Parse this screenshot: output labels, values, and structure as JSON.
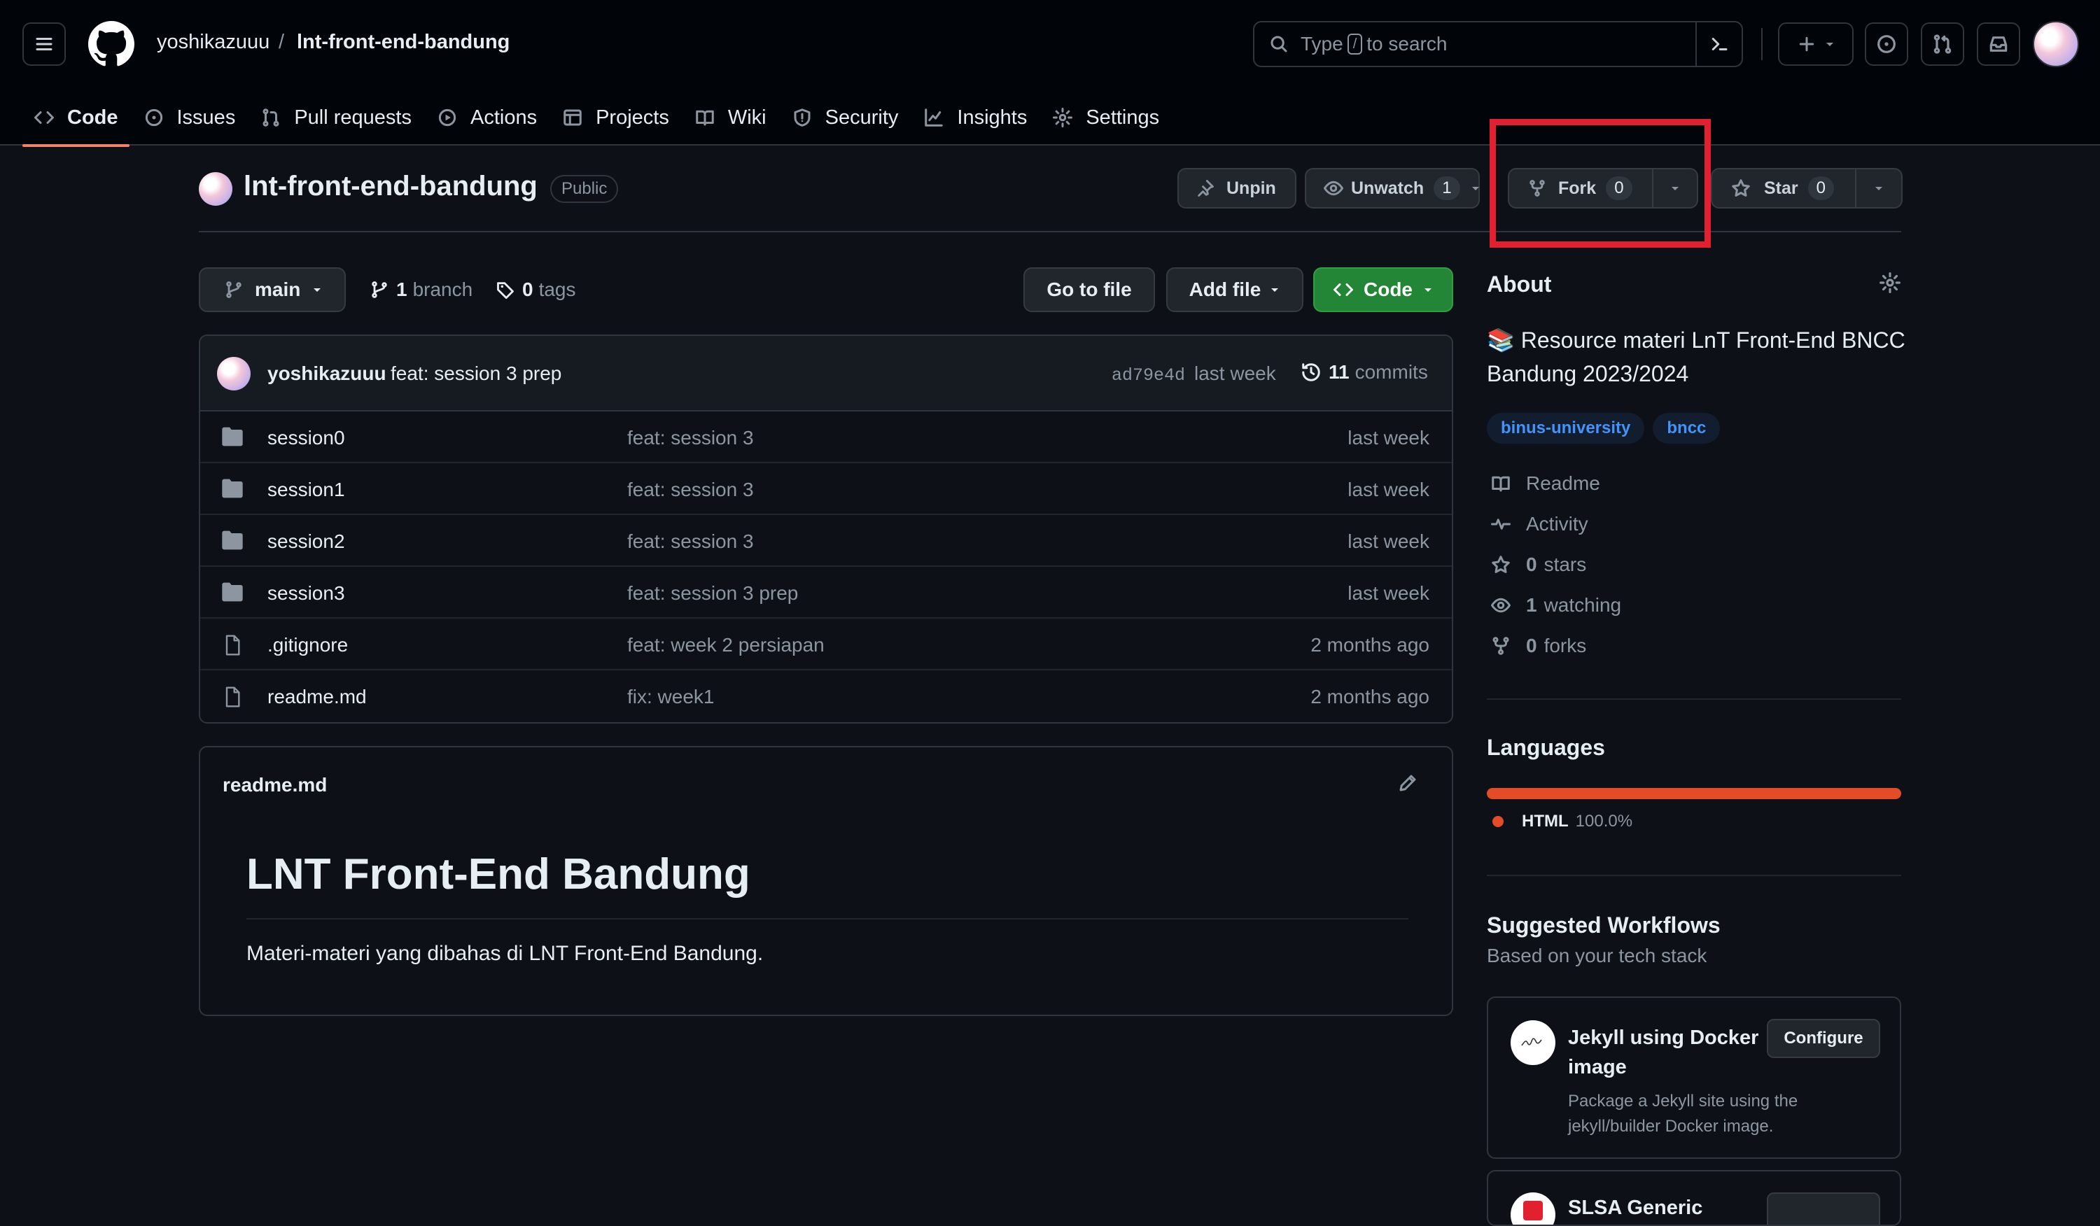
{
  "header": {
    "owner": "yoshikazuuu",
    "separator": "/",
    "repo": "lnt-front-end-bandung",
    "search": {
      "prefix": "Type",
      "key": "/",
      "suffix": "to search"
    },
    "icons": [
      "menu-icon",
      "github-logo",
      "search-icon",
      "command-palette-icon",
      "plus-icon",
      "issue-icon",
      "pull-request-icon",
      "inbox-icon"
    ]
  },
  "tabs": [
    {
      "label": "Code",
      "icon": "code-icon",
      "active": true
    },
    {
      "label": "Issues",
      "icon": "issue-icon"
    },
    {
      "label": "Pull requests",
      "icon": "pull-request-icon"
    },
    {
      "label": "Actions",
      "icon": "play-icon"
    },
    {
      "label": "Projects",
      "icon": "table-icon"
    },
    {
      "label": "Wiki",
      "icon": "book-icon"
    },
    {
      "label": "Security",
      "icon": "shield-icon"
    },
    {
      "label": "Insights",
      "icon": "graph-icon"
    },
    {
      "label": "Settings",
      "icon": "gear-icon"
    }
  ],
  "repo": {
    "title": "lnt-front-end-bandung",
    "visibility": "Public",
    "actions": {
      "unpin": "Unpin",
      "unwatch": "Unwatch",
      "watch_count": "1",
      "fork": "Fork",
      "fork_count": "0",
      "star": "Star",
      "star_count": "0"
    },
    "highlight_color": "#e3202f"
  },
  "toolbar": {
    "branch": "main",
    "branch_count": "1",
    "branch_label": "branch",
    "tag_count": "0",
    "tag_label": "tags",
    "go_to_file": "Go to file",
    "add_file": "Add file",
    "code": "Code"
  },
  "commit": {
    "author": "yoshikazuuu",
    "message": "feat: session 3 prep",
    "sha": "ad79e4d",
    "time": "last week",
    "count": "11",
    "count_label": "commits"
  },
  "files": [
    {
      "name": "session0",
      "type": "folder",
      "message": "feat: session 3",
      "time": "last week"
    },
    {
      "name": "session1",
      "type": "folder",
      "message": "feat: session 3",
      "time": "last week"
    },
    {
      "name": "session2",
      "type": "folder",
      "message": "feat: session 3",
      "time": "last week"
    },
    {
      "name": "session3",
      "type": "folder",
      "message": "feat: session 3 prep",
      "time": "last week"
    },
    {
      "name": ".gitignore",
      "type": "file",
      "message": "feat: week 2 persiapan",
      "time": "2 months ago"
    },
    {
      "name": "readme.md",
      "type": "file",
      "message": "fix: week1",
      "time": "2 months ago"
    }
  ],
  "readme": {
    "filename": "readme.md",
    "heading": "LNT Front-End Bandung",
    "paragraph": "Materi-materi yang dibahas di LNT Front-End Bandung."
  },
  "about": {
    "title": "About",
    "description": "📚 Resource materi LnT Front-End BNCC Bandung 2023/2024",
    "topics": [
      "binus-university",
      "bncc"
    ],
    "items": [
      {
        "icon": "book-icon",
        "value": "",
        "label": "Readme"
      },
      {
        "icon": "pulse-icon",
        "value": "",
        "label": "Activity"
      },
      {
        "icon": "star-icon",
        "value": "0",
        "label": "stars"
      },
      {
        "icon": "eye-icon",
        "value": "1",
        "label": "watching"
      },
      {
        "icon": "fork-icon",
        "value": "0",
        "label": "forks"
      }
    ]
  },
  "languages": {
    "title": "Languages",
    "items": [
      {
        "name": "HTML",
        "percent": "100.0%",
        "color": "#e34c26"
      }
    ]
  },
  "workflows": {
    "title": "Suggested Workflows",
    "subtitle": "Based on your tech stack",
    "cards": [
      {
        "name": "Jekyll using Docker image",
        "description": "Package a Jekyll site using the jekyll/builder Docker image.",
        "button": "Configure"
      },
      {
        "name": "SLSA Generic",
        "description": "",
        "button": ""
      }
    ]
  }
}
